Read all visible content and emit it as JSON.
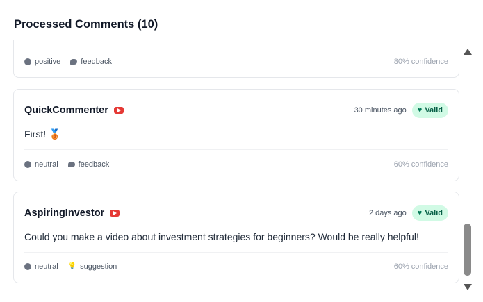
{
  "header": {
    "title": "Processed Comments (10)"
  },
  "comments": [
    {
      "sentiment": "positive",
      "category": "feedback",
      "confidence": "80% confidence"
    },
    {
      "author": "QuickCommenter",
      "platform_icon": "youtube-icon",
      "time": "30 minutes ago",
      "status": "Valid",
      "text": "First! 🥉",
      "sentiment": "neutral",
      "category": "feedback",
      "category_icon": "chat-bubble-icon",
      "confidence": "60% confidence"
    },
    {
      "author": "AspiringInvestor",
      "platform_icon": "youtube-icon",
      "time": "2 days ago",
      "status": "Valid",
      "text": "Could you make a video about investment strategies for beginners? Would be really helpful!",
      "sentiment": "neutral",
      "category": "suggestion",
      "category_icon": "lightbulb-icon",
      "confidence": "60% confidence"
    }
  ],
  "colors": {
    "valid_bg": "#d1fae5",
    "valid_text": "#065f46",
    "youtube": "#e53935"
  }
}
